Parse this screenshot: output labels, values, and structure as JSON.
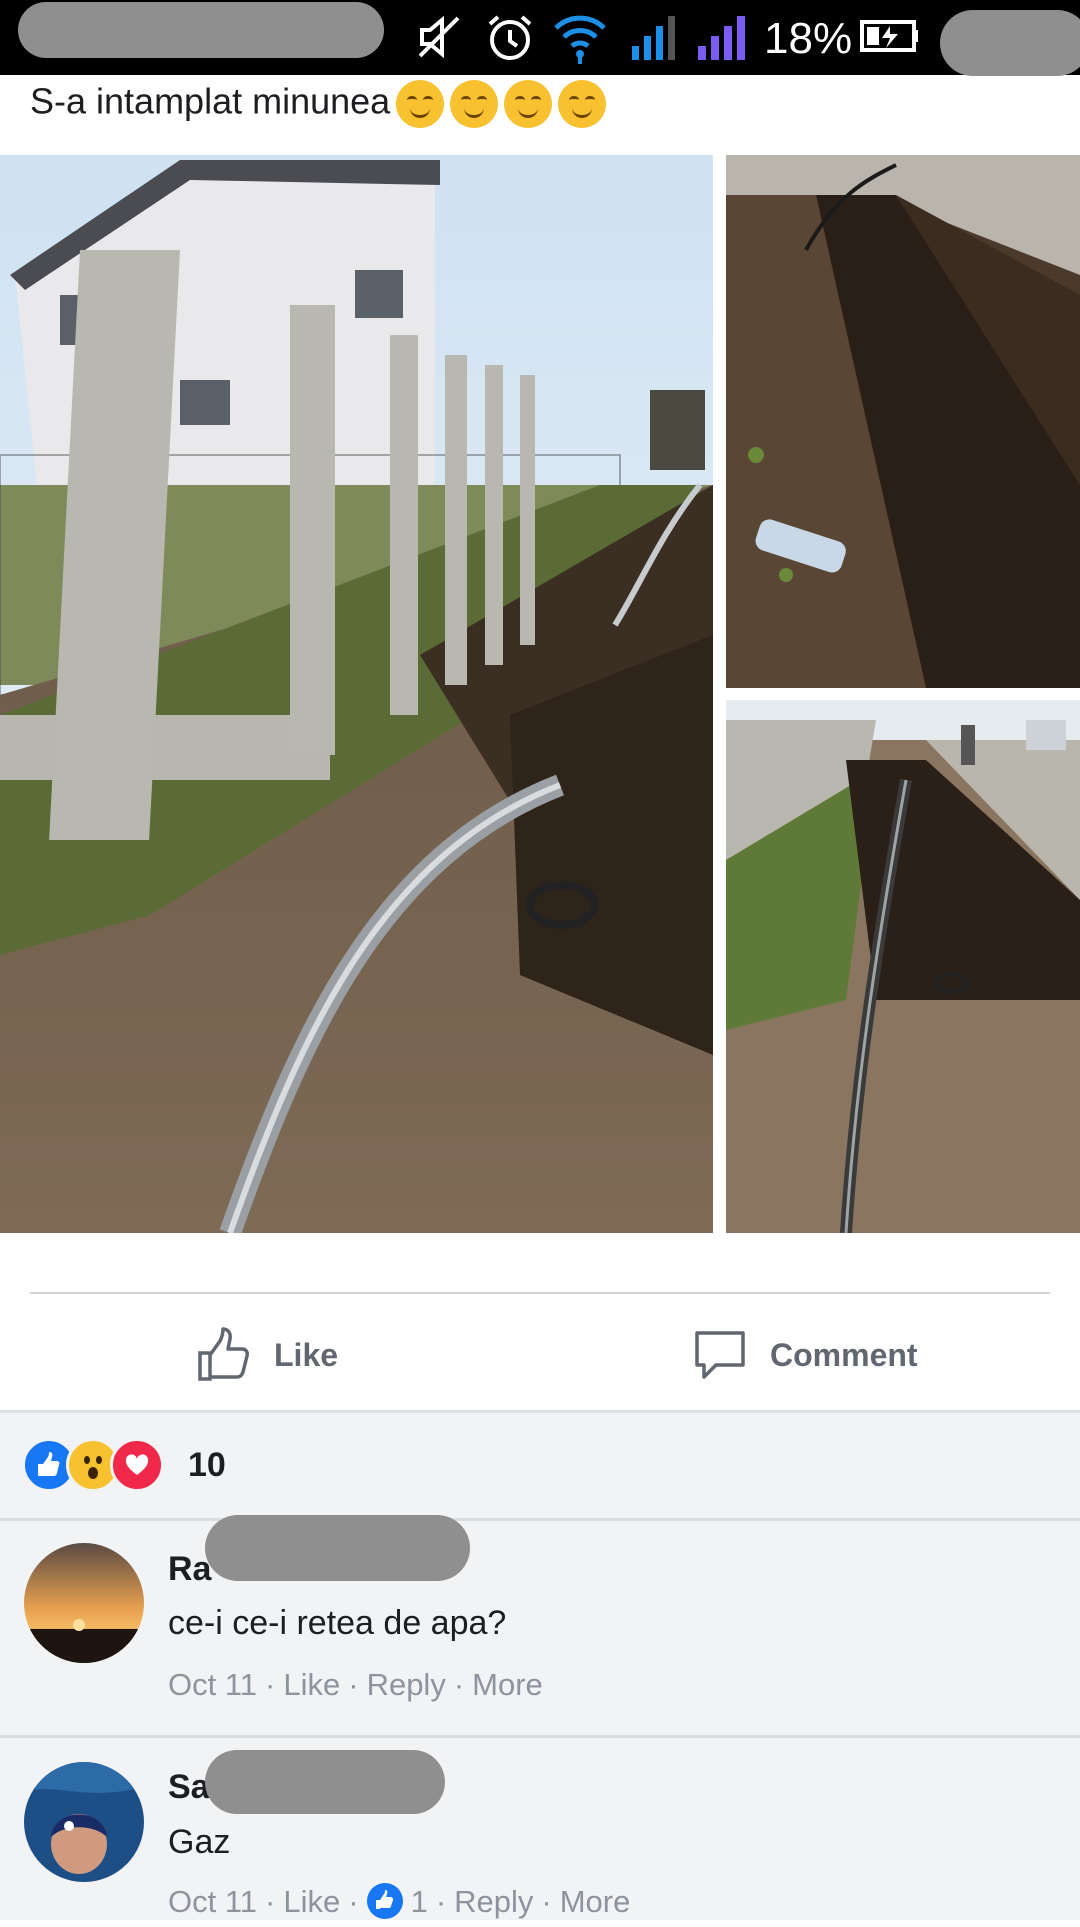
{
  "status_bar": {
    "battery": "18%"
  },
  "post": {
    "text": "S-a intamplat minunea",
    "emoji_count": 4
  },
  "actions": {
    "like_label": "Like",
    "comment_label": "Comment"
  },
  "reactions": {
    "count": "10",
    "types": [
      "like-icon",
      "wow-icon",
      "love-icon"
    ]
  },
  "comments": [
    {
      "name": "Ra",
      "text": "ce-i ce-i retea de apa?",
      "meta": {
        "time": "Oct 11",
        "like": "Like",
        "reply": "Reply",
        "more": "More"
      }
    },
    {
      "name": "Sa",
      "text": "Gaz",
      "meta": {
        "time": "Oct 11",
        "like": "Like",
        "like_count": "1",
        "reply": "Reply",
        "more": "More"
      }
    }
  ],
  "colors": {
    "meta_gray": "#8d949e",
    "fb_blue": "#1877f2",
    "love_red": "#f0284a",
    "bg_gray": "#f2f3f5"
  }
}
